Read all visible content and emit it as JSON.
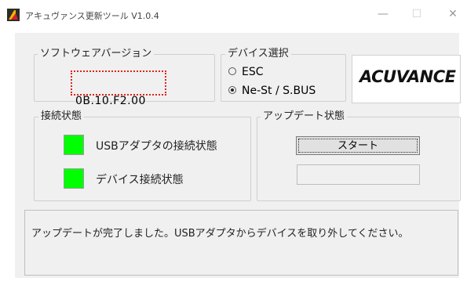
{
  "window": {
    "title": "アキュヴァンス更新ツール V1.0.4",
    "controls": {
      "minimize": "—",
      "maximize": "☐",
      "close": "✕"
    }
  },
  "software_version": {
    "legend": "ソフトウェアバージョン",
    "value": "0B.10.F2.00",
    "highlight_color": "#e0221e"
  },
  "device_select": {
    "legend": "デバイス選択",
    "options": [
      {
        "label": "ESC",
        "selected": false
      },
      {
        "label": "Ne-St / S.BUS",
        "selected": true
      }
    ]
  },
  "logo": {
    "text": "ACUVANCE"
  },
  "connection_status": {
    "legend": "接続状態",
    "items": [
      {
        "label": "USBアダプタの接続状態",
        "indicator_color": "#00ff00"
      },
      {
        "label": "デバイス接続状態",
        "indicator_color": "#00ff00"
      }
    ]
  },
  "update_status": {
    "legend": "アップデート状態",
    "start_label": "スタート",
    "progress": 0
  },
  "message": "アップデートが完了しました。USBアダプタからデバイスを取り外してください。"
}
